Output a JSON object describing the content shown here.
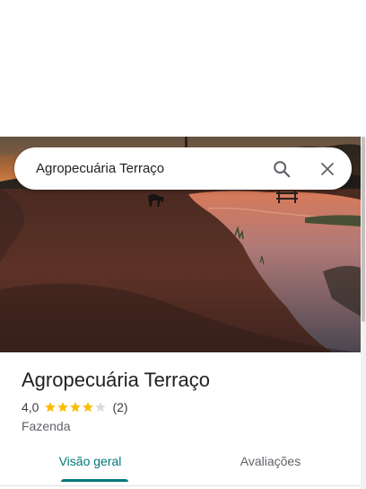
{
  "search": {
    "query": "Agropecuária Terraço",
    "search_icon": "search-icon",
    "close_icon": "close-icon"
  },
  "hero": {
    "image": "sunset-farm-photo"
  },
  "place": {
    "title": "Agropecuária Terraço",
    "rating": "4,0",
    "stars_filled": 4,
    "stars_total": 5,
    "review_count": "(2)",
    "category": "Fazenda"
  },
  "tabs": [
    {
      "label": "Visão geral",
      "active": true
    },
    {
      "label": "Avaliações",
      "active": false
    }
  ],
  "colors": {
    "accent": "#00787a",
    "star": "#fbbc04",
    "star_empty": "#dadce0",
    "text_primary": "#202124",
    "text_secondary": "#5f6368"
  }
}
